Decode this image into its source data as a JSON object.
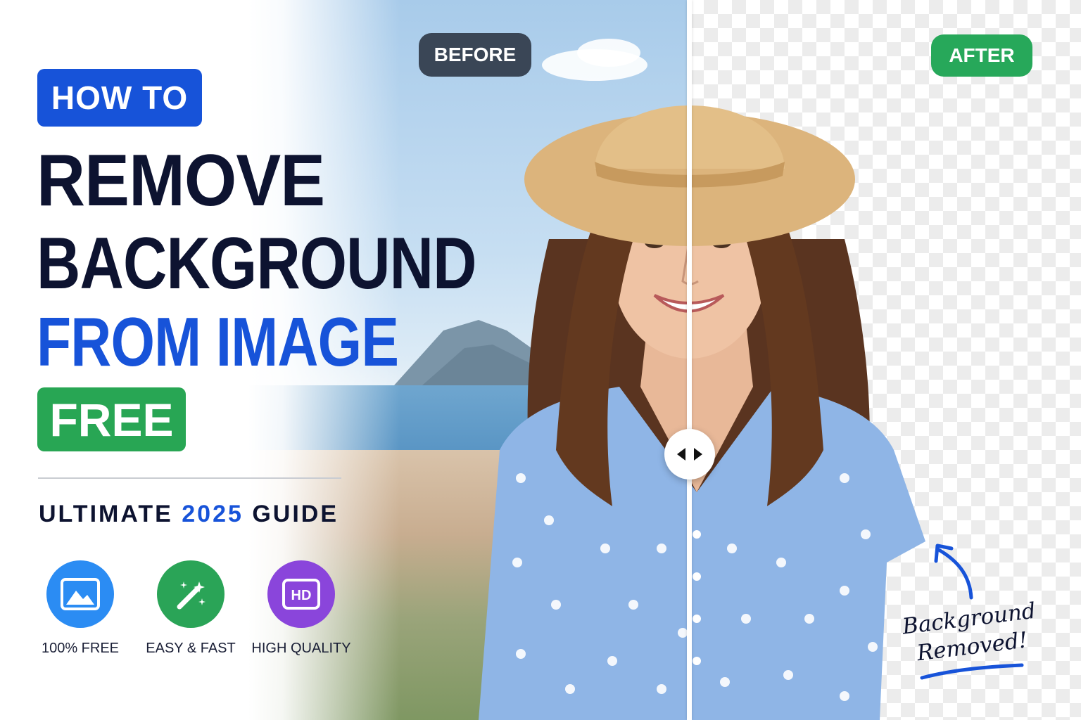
{
  "badges": {
    "before": "BEFORE",
    "after": "AFTER"
  },
  "headline": {
    "how_to": "HOW TO",
    "line1": "REMOVE",
    "line2": "BACKGROUND",
    "line3": "FROM IMAGE",
    "free": "FREE"
  },
  "guide": {
    "prefix": "ULTIMATE",
    "year": "2025",
    "suffix": "GUIDE"
  },
  "features": [
    {
      "label": "100% FREE",
      "icon": "image-icon",
      "color": "#2b8cf3"
    },
    {
      "label": "EASY & FAST",
      "icon": "magic-wand-icon",
      "color": "#2aa457"
    },
    {
      "label": "HIGH QUALITY",
      "icon": "hd-icon",
      "color": "#8a45db"
    }
  ],
  "annotation": {
    "line1": "Background",
    "line2": "Removed!"
  },
  "colors": {
    "brand_blue": "#1753d9",
    "brand_green": "#28a654",
    "dark_navy": "#0d1330",
    "before_badge": "#3a4656"
  },
  "comparison_slider": {
    "handle_icon": "left-right-arrows-icon"
  }
}
